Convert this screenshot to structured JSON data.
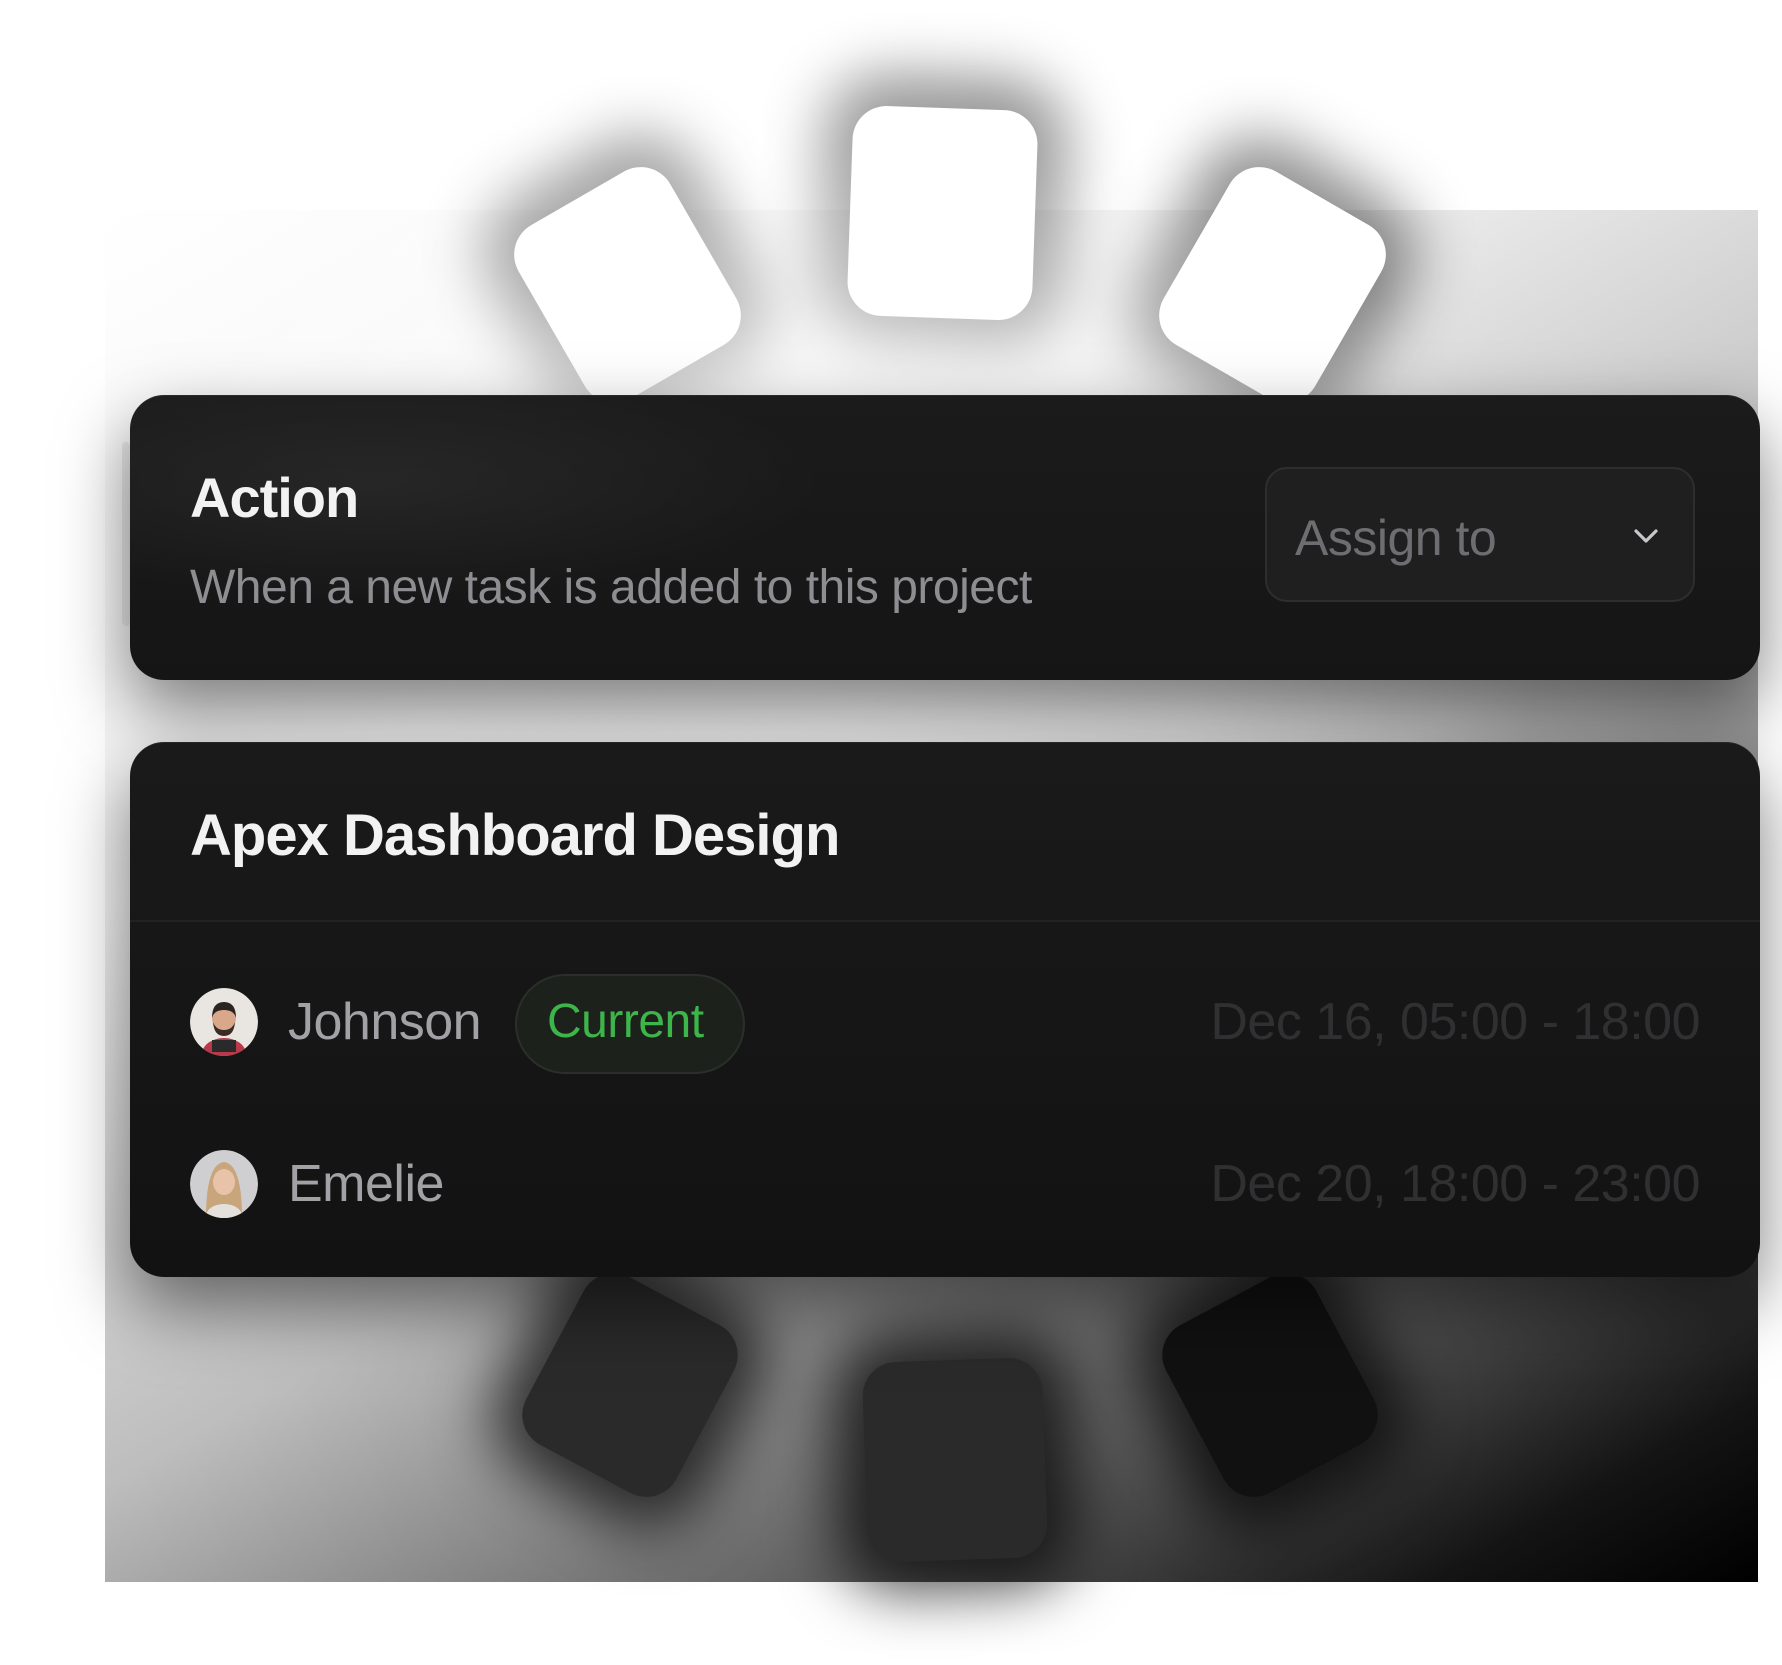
{
  "action_card": {
    "title": "Action",
    "subtitle": "When a new task is added to this project",
    "select": {
      "value": "Assign to",
      "icon": "chevron-down-icon"
    }
  },
  "project_card": {
    "title": "Apex Dashboard Design",
    "rows": [
      {
        "name": "Johnson",
        "badge": "Current",
        "time": "Dec 16, 05:00 - 18:00",
        "avatar": "avatar-johnson"
      },
      {
        "name": "Emelie",
        "time": "Dec 20, 18:00 - 23:00",
        "avatar": "avatar-emelie"
      }
    ]
  },
  "colors": {
    "card_bg": "#161616",
    "title_text": "#f2f2f2",
    "muted_text": "#8e8e92",
    "badge_green": "#3db54a"
  }
}
